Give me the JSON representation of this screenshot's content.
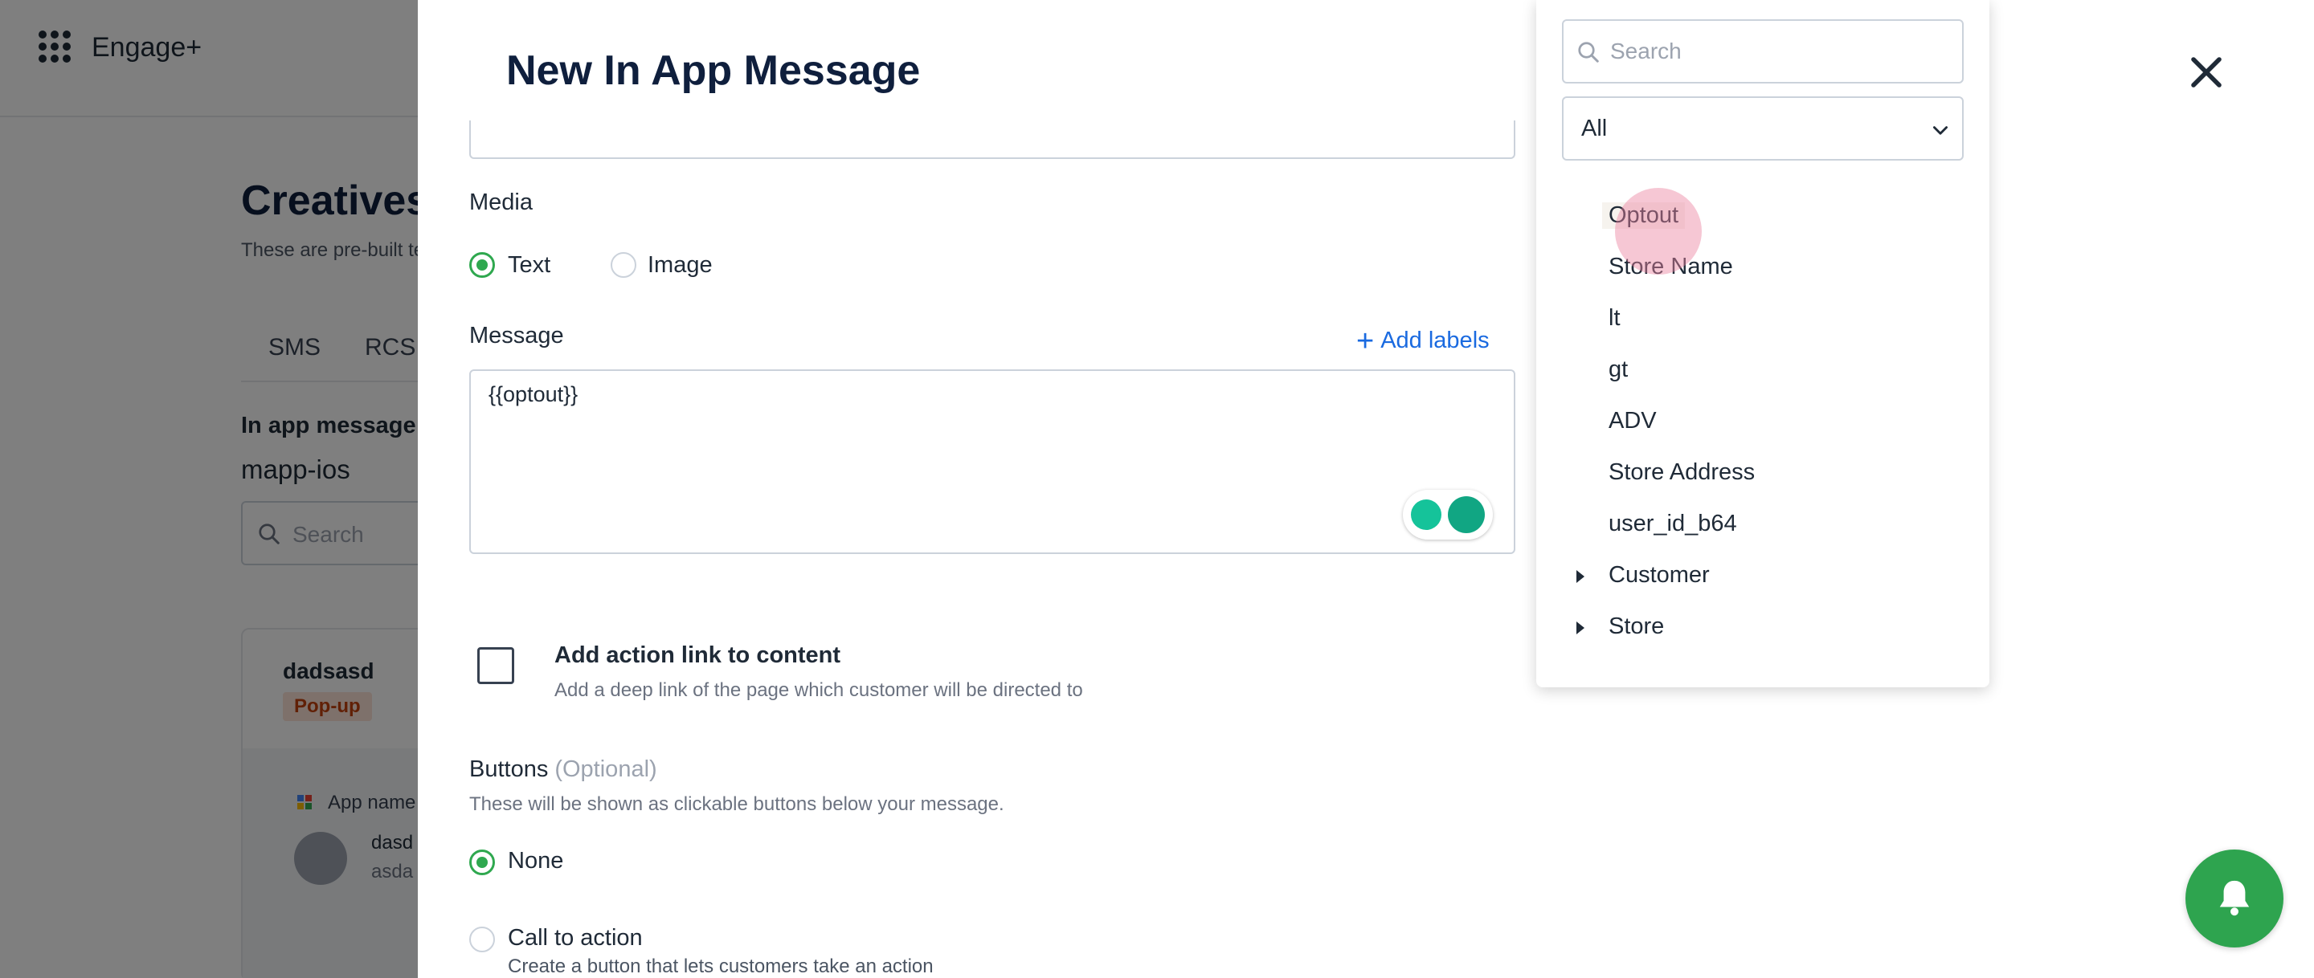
{
  "background": {
    "app_title": "Engage+",
    "page_title": "Creatives",
    "page_subtitle": "These are pre-built te",
    "tabs": [
      "SMS",
      "RCS"
    ],
    "section_label": "In app message a",
    "app_name": "mapp-ios",
    "search_placeholder": "Search",
    "card": {
      "title": "dadsasd",
      "badge": "Pop-up",
      "preview_app_name": "App name",
      "preview_line1": "dasd",
      "preview_line2": "asda"
    }
  },
  "modal": {
    "title": "New In App Message",
    "media_label": "Media",
    "media_options": [
      {
        "label": "Text",
        "selected": true
      },
      {
        "label": "Image",
        "selected": false
      }
    ],
    "message_label": "Message",
    "add_labels": "Add labels",
    "message_value": "{{optout}}",
    "action_link_title": "Add action link to content",
    "action_link_sub": "Add a deep link of the page which customer will be directed to",
    "action_link_checked": false,
    "buttons_title": "Buttons",
    "buttons_optional": "(Optional)",
    "buttons_sub": "These will be shown as clickable buttons below your message.",
    "button_options": [
      {
        "label": "None",
        "selected": true
      },
      {
        "label": "Call to action",
        "selected": false
      }
    ],
    "cta_sub": "Create a button that lets customers take an action"
  },
  "dropdown": {
    "search_placeholder": "Search",
    "filter_value": "All",
    "items": [
      {
        "label": "Optout",
        "group": false
      },
      {
        "label": "Store Name",
        "group": false
      },
      {
        "label": "lt",
        "group": false
      },
      {
        "label": "gt",
        "group": false
      },
      {
        "label": "ADV",
        "group": false
      },
      {
        "label": "Store Address",
        "group": false
      },
      {
        "label": "user_id_b64",
        "group": false
      },
      {
        "label": "Customer",
        "group": true
      },
      {
        "label": "Store",
        "group": true
      }
    ]
  },
  "colors": {
    "accent_green": "#2ea44f",
    "link_blue": "#1a6ae0",
    "title_navy": "#0f1f3d",
    "badge_bg": "#fde2d6",
    "badge_text": "#c2410c"
  },
  "icons": [
    "apps-grid-icon",
    "search-icon",
    "close-icon",
    "plus-icon",
    "chevron-down-icon",
    "caret-right-icon",
    "bell-icon",
    "grammarly-icon",
    "avatar-icon"
  ]
}
